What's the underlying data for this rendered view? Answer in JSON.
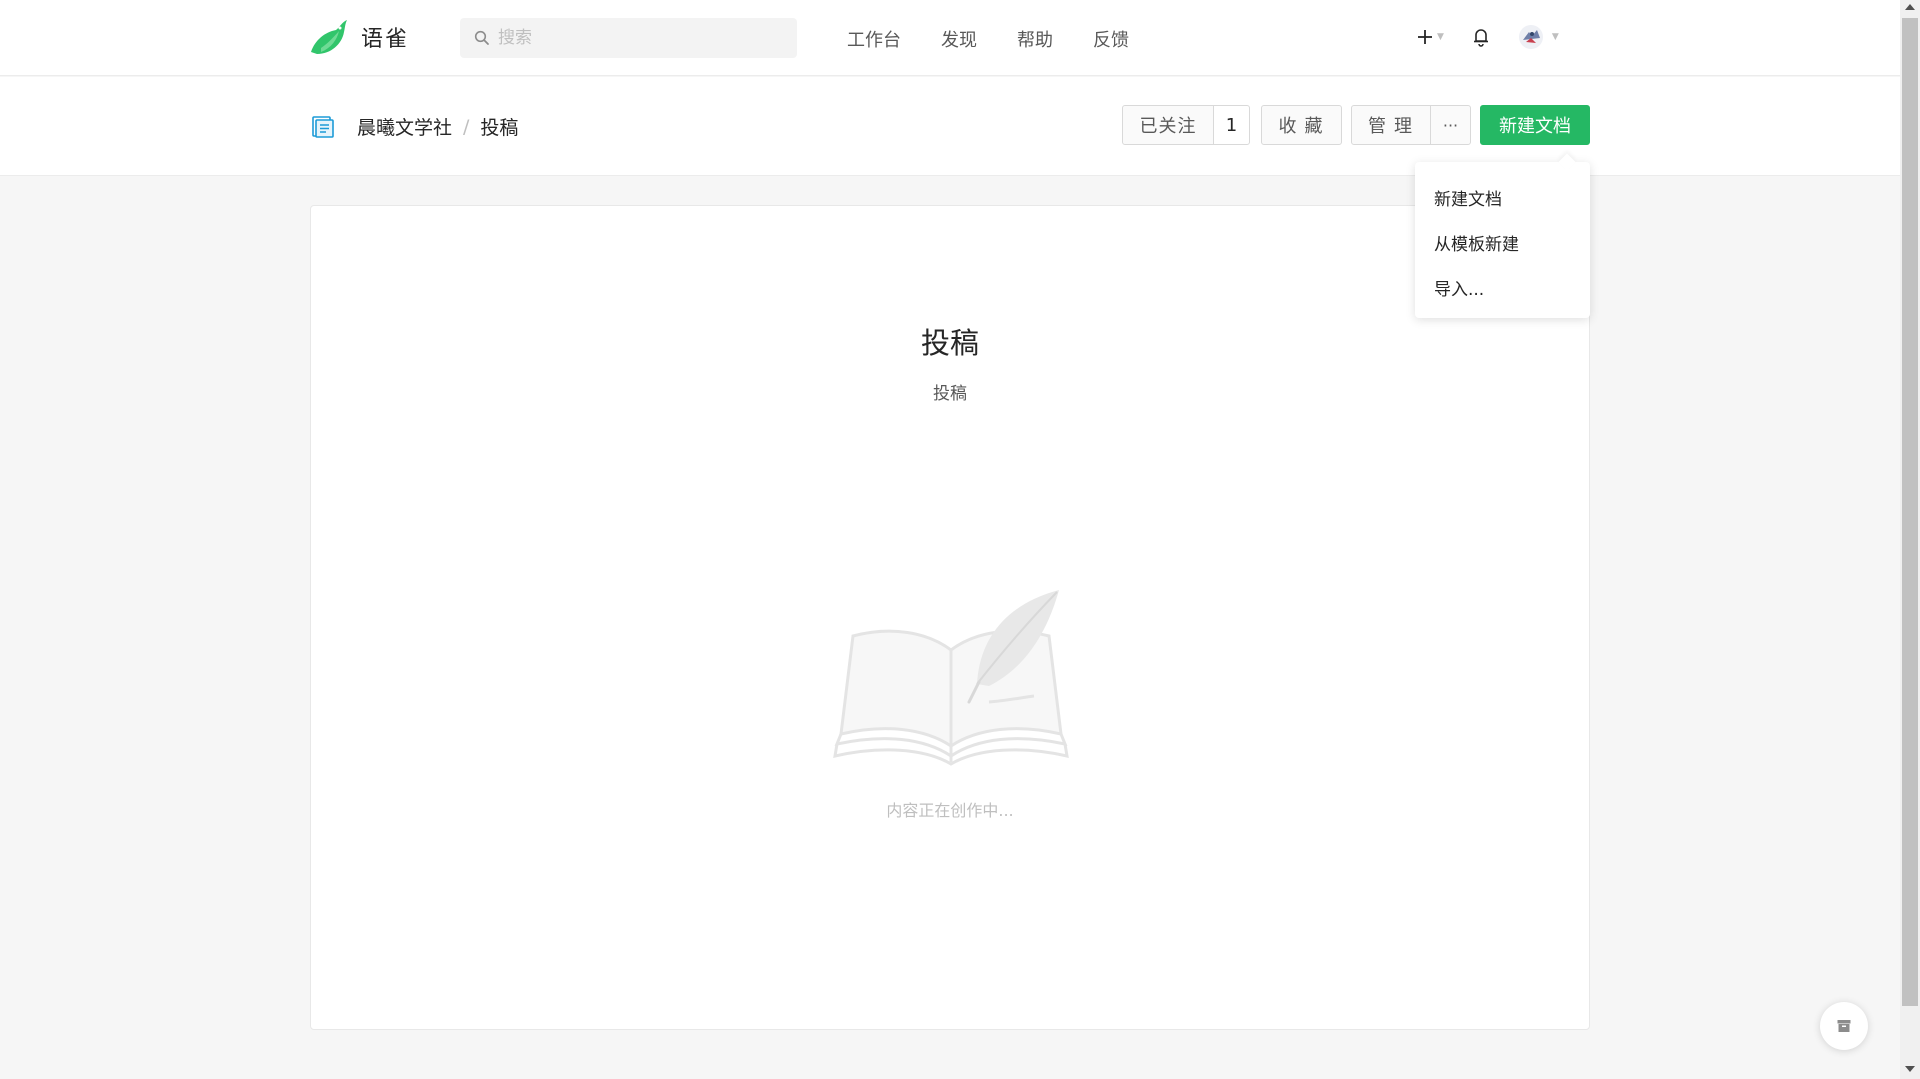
{
  "header": {
    "app_name": "语雀",
    "search": {
      "placeholder": "搜索",
      "value": ""
    },
    "nav": [
      {
        "label": "工作台"
      },
      {
        "label": "发现"
      },
      {
        "label": "帮助"
      },
      {
        "label": "反馈"
      }
    ],
    "icons": {
      "add": "plus-icon",
      "notifications": "bell-icon",
      "avatar": "user-avatar"
    }
  },
  "subheader": {
    "breadcrumb": {
      "group": "晨曦文学社",
      "separator": "/",
      "current": "投稿"
    },
    "follow_label": "已关注",
    "follow_count": "1",
    "collect_label": "收藏",
    "manage_label": "管理",
    "more_label": "···",
    "new_doc_label": "新建文档"
  },
  "dropdown": {
    "items": [
      {
        "label": "新建文档"
      },
      {
        "label": "从模板新建"
      },
      {
        "label": "导入..."
      }
    ]
  },
  "main": {
    "title": "投稿",
    "description": "投稿",
    "empty_text": "内容正在创作中..."
  },
  "colors": {
    "primary": "#25b864",
    "brand_logo": "#31c56b"
  }
}
